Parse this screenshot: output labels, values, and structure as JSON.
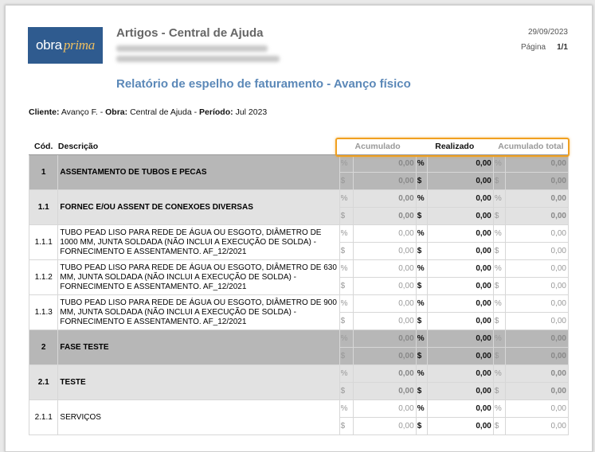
{
  "header": {
    "logo_part1": "obra",
    "logo_part2": "prima",
    "company": "Artigos - Central de Ajuda",
    "date": "29/09/2023",
    "page_label": "Página",
    "page_value": "1/1",
    "report_title": "Relatório de espelho de faturamento - Avanço físico"
  },
  "filter": {
    "client_label": "Cliente:",
    "client": "Avanço F. -",
    "obra_label": "Obra:",
    "obra": "Central de Ajuda -",
    "period_label": "Período:",
    "period": "Jul 2023"
  },
  "table": {
    "headers": [
      "Cód.",
      "Descrição",
      "Acumulado",
      "Realizado",
      "Acumulado total"
    ],
    "rows": [
      {
        "code": "1",
        "desc": "ASSENTAMENTO DE TUBOS E PECAS",
        "level": 1,
        "vals": [
          "0,00",
          "0,00",
          "0,00",
          "0,00",
          "0,00",
          "0,00"
        ]
      },
      {
        "code": "1.1",
        "desc": "FORNEC E/OU ASSENT DE CONEXOES DIVERSAS",
        "level": 2,
        "vals": [
          "0,00",
          "0,00",
          "0,00",
          "0,00",
          "0,00",
          "0,00"
        ]
      },
      {
        "code": "1.1.1",
        "desc": "TUBO PEAD LISO PARA REDE DE ÁGUA OU ESGOTO, DIÂMETRO DE 1000 MM, JUNTA SOLDADA (NÃO INCLUI A EXECUÇÃO DE SOLDA) - FORNECIMENTO E ASSENTAMENTO. AF_12/2021",
        "level": 3,
        "vals": [
          "0,00",
          "0,00",
          "0,00",
          "0,00",
          "0,00",
          "0,00"
        ]
      },
      {
        "code": "1.1.2",
        "desc": "TUBO PEAD LISO PARA REDE DE ÁGUA OU ESGOTO, DIÂMETRO DE 630 MM, JUNTA SOLDADA (NÃO INCLUI A EXECUÇÃO DE SOLDA) - FORNECIMENTO E ASSENTAMENTO. AF_12/2021",
        "level": 3,
        "vals": [
          "0,00",
          "0,00",
          "0,00",
          "0,00",
          "0,00",
          "0,00"
        ]
      },
      {
        "code": "1.1.3",
        "desc": "TUBO PEAD LISO PARA REDE DE ÁGUA OU ESGOTO, DIÂMETRO DE 900 MM, JUNTA SOLDADA (NÃO INCLUI A EXECUÇÃO DE SOLDA) - FORNECIMENTO E ASSENTAMENTO. AF_12/2021",
        "level": 3,
        "vals": [
          "0,00",
          "0,00",
          "0,00",
          "0,00",
          "0,00",
          "0,00"
        ]
      },
      {
        "code": "2",
        "desc": "FASE TESTE",
        "level": 1,
        "vals": [
          "0,00",
          "0,00",
          "0,00",
          "0,00",
          "0,00",
          "0,00"
        ]
      },
      {
        "code": "2.1",
        "desc": "TESTE",
        "level": 2,
        "vals": [
          "0,00",
          "0,00",
          "0,00",
          "0,00",
          "0,00",
          "0,00"
        ]
      },
      {
        "code": "2.1.1",
        "desc": "SERVIÇOS",
        "level": 3,
        "vals": [
          "0,00",
          "0,00",
          "0,00",
          "0,00",
          "0,00",
          "0,00"
        ]
      }
    ]
  },
  "symbols": {
    "percent": "%",
    "currency": "$"
  },
  "colors": {
    "title_blue": "#5b88b8",
    "logo_blue": "#2f5b8f",
    "highlight": "#f0a020"
  }
}
